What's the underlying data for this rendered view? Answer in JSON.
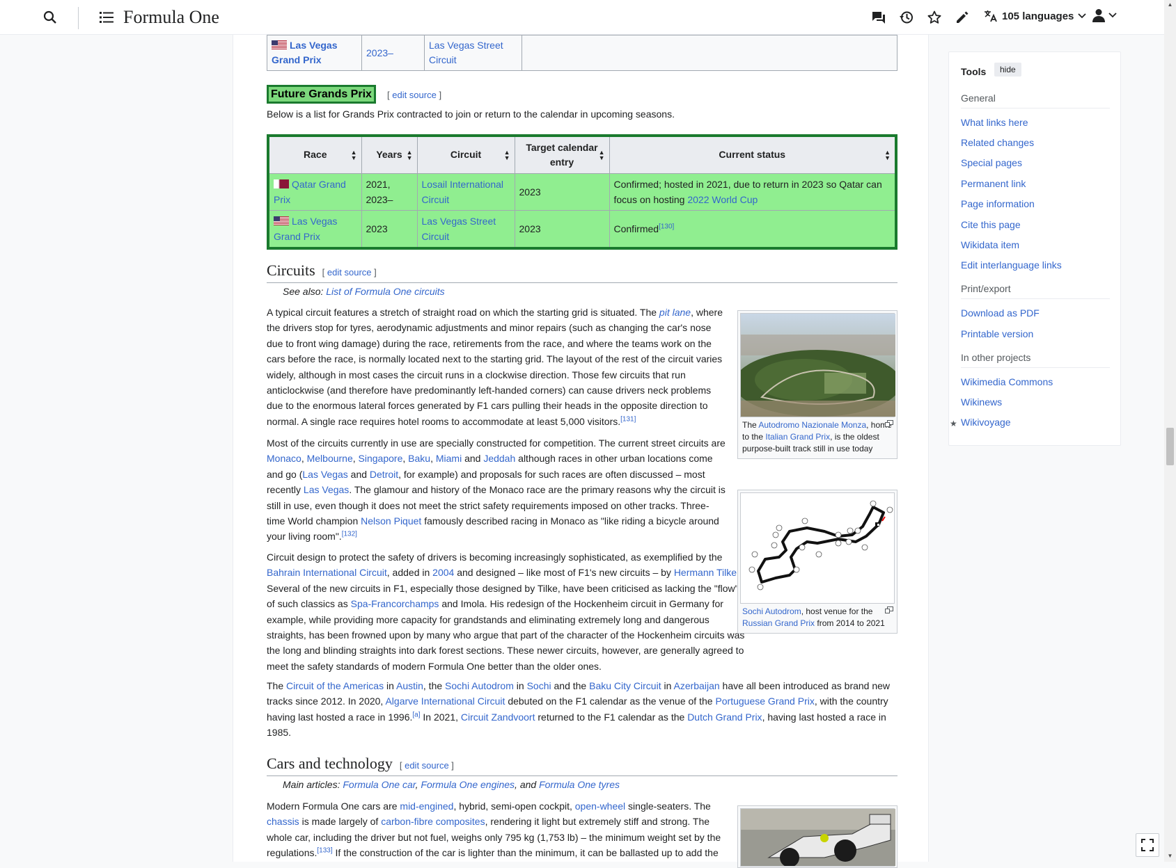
{
  "header": {
    "site_title": "Formula One",
    "languages_label": "105 languages"
  },
  "top_table": {
    "race": "Las Vegas Grand Prix",
    "years": "2023–",
    "circuit": "Las Vegas Street Circuit"
  },
  "future": {
    "heading": "Future Grands Prix",
    "edit_label": "edit source",
    "intro": "Below is a list for Grands Prix contracted to join or return to the calendar in upcoming seasons.",
    "headers": [
      "Race",
      "Years",
      "Circuit",
      "Target calendar entry",
      "Current status"
    ],
    "rows": [
      {
        "race": "Qatar Grand Prix",
        "years": "2021, 2023–",
        "circuit": "Losail International Circuit",
        "target": "2023",
        "status_a": "Confirmed; hosted in 2021, due to return in 2023 so Qatar can focus on hosting ",
        "status_link": "2022 World Cup",
        "status_ref": ""
      },
      {
        "race": "Las Vegas Grand Prix",
        "years": "2023",
        "circuit": "Las Vegas Street Circuit",
        "target": "2023",
        "status_a": "Confirmed",
        "status_link": "",
        "status_ref": "[130]"
      }
    ]
  },
  "circuits": {
    "heading": "Circuits",
    "edit_label": "edit source",
    "see_also_prefix": "See also: ",
    "see_also_link": "List of Formula One circuits",
    "refs": {
      "r131": "[131]",
      "r132": "[132]",
      "ra": "[a]"
    },
    "thumb1_caption": {
      "pre": "The ",
      "l1": "Autodromo Nazionale Monza",
      "mid": ", home to the ",
      "l2": "Italian Grand Prix",
      "post": ", is the oldest purpose-built track still in use today"
    },
    "thumb2_caption": {
      "l1": "Sochi Autodrom",
      "mid": ", host venue for the ",
      "l2": "Russian Grand Prix",
      "post": " from 2014 to 2021"
    }
  },
  "cars": {
    "heading": "Cars and technology",
    "edit_label": "edit source",
    "main_prefix": "Main articles: ",
    "main_links": [
      "Formula One car",
      "Formula One engines",
      "Formula One tyres"
    ],
    "ref133": "[133]"
  },
  "tools": {
    "title": "Tools",
    "hide_label": "hide",
    "group_general": "General",
    "general_items": [
      "What links here",
      "Related changes",
      "Special pages",
      "Permanent link",
      "Page information",
      "Cite this page",
      "Wikidata item",
      "Edit interlanguage links"
    ],
    "group_print": "Print/export",
    "print_items": [
      "Download as PDF",
      "Printable version"
    ],
    "group_projects": "In other projects",
    "project_items": [
      "Wikimedia Commons",
      "Wikinews",
      "Wikivoyage"
    ]
  },
  "colors": {
    "link": "#3366cc",
    "table_green": "#90ee90",
    "border_green": "#1a7a2e"
  }
}
